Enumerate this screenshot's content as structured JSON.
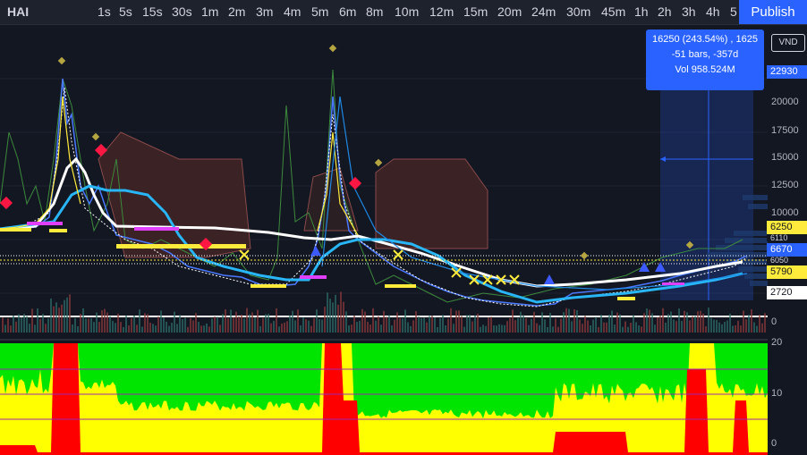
{
  "header": {
    "symbol": "HAI",
    "timeframes": [
      "1s",
      "5s",
      "15s",
      "30s",
      "1m",
      "2m",
      "3m",
      "4m",
      "5m",
      "6m",
      "8m",
      "10m",
      "12m",
      "15m",
      "20m",
      "24m",
      "30m",
      "45m",
      "1h",
      "2h",
      "3h",
      "4h",
      "5"
    ],
    "publish_label": "Publish"
  },
  "tooltip": {
    "line1": "16250 (243.54%) , 1625",
    "line2": "-51 bars, -357d",
    "line3": "Vol 958.524M"
  },
  "currency": "VND",
  "price_axis": {
    "ticks": [
      "20000",
      "17500",
      "15000",
      "12500",
      "10000",
      "0"
    ],
    "labels": {
      "top": "22930",
      "l6250": "6250",
      "l6110": "6110",
      "l6670": "6670",
      "l6050": "6050",
      "l5790": "5790",
      "l2720": "2720"
    }
  },
  "indicator_axis": {
    "ticks": [
      "20",
      "10",
      "0"
    ]
  },
  "colors": {
    "accent": "#2962ff",
    "bullish": "#26a69a",
    "bearish": "#ef5350",
    "indicator_green": "#00e500",
    "indicator_yellow": "#ffff00",
    "indicator_red": "#ff0000"
  }
}
